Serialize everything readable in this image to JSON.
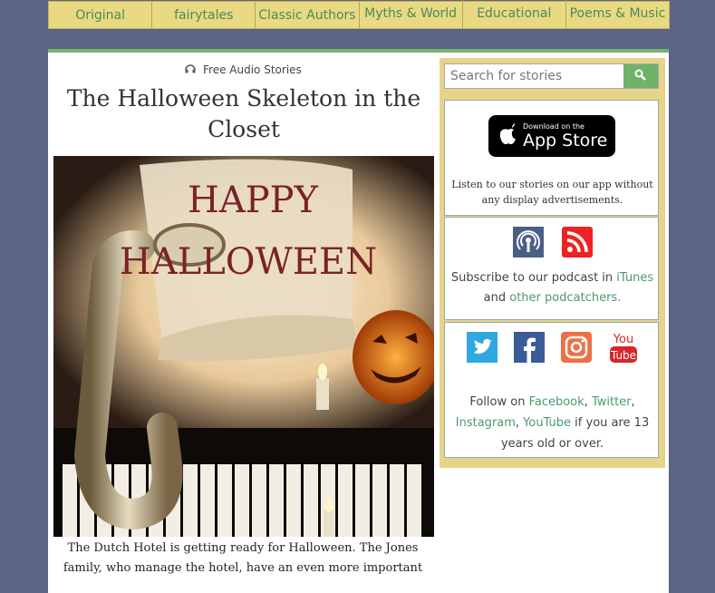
{
  "nav": {
    "items": [
      "Original",
      "fairytales",
      "Classic Authors",
      "Myths & World",
      "Educational",
      "Poems & Music"
    ]
  },
  "article": {
    "kicker": "Free Audio Stories",
    "title": "The Halloween Skeleton in the Closet",
    "hero_text_line1": "HAPPY",
    "hero_text_line2": "HALLOWEEN",
    "caption": "The Dutch Hotel is getting ready for Halloween. The Jones family, who manage the hotel, have an even more important"
  },
  "sidebar": {
    "search_placeholder": "Search for stories",
    "appstore": {
      "small": "Download on the",
      "big": "App Store"
    },
    "app_desc": "Listen to our stories on our app without any display advertisements.",
    "podcast": {
      "text1": "Subscribe to our podcast in ",
      "link1": "iTunes",
      "text2": "and ",
      "link2": "other podcatchers."
    },
    "social": {
      "text1": "Follow on ",
      "link_facebook": "Facebook",
      "sep1": ", ",
      "link_twitter": "Twitter",
      "sep2": ", ",
      "link_instagram": "Instagram",
      "sep3": ", ",
      "link_youtube": "YouTube",
      "text2": " if you are 13 years old or over.",
      "youtube_icon_top": "You",
      "youtube_icon_bottom": "Tube"
    }
  },
  "colors": {
    "background": "#5a6585",
    "nav_bg": "#e9d983",
    "accent_green": "#77b36f",
    "link": "#4c9a6a"
  }
}
